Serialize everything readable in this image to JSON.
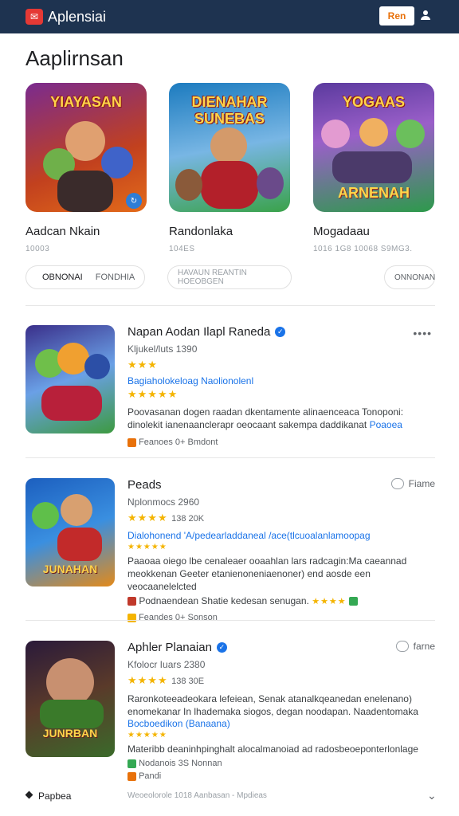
{
  "topbar": {
    "app_title": "Aplensiai",
    "button_label": "Ren"
  },
  "section_title": "Aaplirnsan",
  "featured": [
    {
      "thumb_text": "YIAYASAN",
      "name": "Aadcan Nkain",
      "sub": "10003",
      "colors": [
        "#7a2b8f",
        "#e36b1a"
      ]
    },
    {
      "thumb_text": "DIENAHAR SUNEBAS",
      "name": "Randonlaka",
      "sub": "104ES",
      "colors": [
        "#1c7bbf",
        "#3aa24a"
      ]
    },
    {
      "thumb_text": "YOGAAS",
      "name": "Mogadaau",
      "sub": "1016 1G8 10068 S9MG3.",
      "colors": [
        "#5b3a9e",
        "#2d9a4b"
      ]
    }
  ],
  "chips": {
    "left_a": "OBNONAI",
    "left_b": "FONDHIA",
    "middle": "HAVAUN REANTIN HOEOBGEN",
    "right": "ONNONAN"
  },
  "rows": [
    {
      "title": "Napan Aodan Ilapl Raneda",
      "meta": "Kljukel/luts 1390",
      "stars": "★★★",
      "link": "Bagiaholokeloag Naolionolenl",
      "stars2": "★★★★★",
      "desc": "Poovasanan dogen raadan dkentamente alinaenceaca Tonoponi: dinolekit ianenaanclerapr oeocaant sakempa daddikanat",
      "desc_link": "Poaoea",
      "foot": "Feanoes 0+ Bmdont"
    },
    {
      "title": "Peads",
      "action": "Fiame",
      "meta": "Nplonmocs 2960",
      "stars": "★★★★",
      "meta2": "138 20K",
      "link": "Dialohonend 'A/pedearladdaneal /ace(tlcuoalanlamoopag",
      "stars2": "★★★★★",
      "desc": "Paaoaa oiego lbe cenaleaer ooaahlan lars radcagin:Ma caeannad meokkenan Geeter etanienoneniaenoner) end aosde een veocaanelelcted",
      "desc2": "Podnaendean Shatie kedesan senugan.",
      "foot": "Feandes 0+ Sonson"
    },
    {
      "title": "Aphler Planaian",
      "action": "farne",
      "meta": "Kfolocr Iuars 2380",
      "stars": "★★★★",
      "meta2": "138 30E",
      "desc": "Raronkoteeadeokara lefeiean, Senak atanalkqeanedan enelenano) enomekanar In lhademaka siogos, degan noodapan. Naadentomaka",
      "link": "Bocboedikon (Banaana)",
      "stars2": "★★★★★",
      "desc2": "Materibb deaninhpinghalt alocalmanoiad ad radosbeoeponterlonlage",
      "foot": "Nodanois 3S Nonnan",
      "foot2": "Pandi"
    }
  ],
  "bottom": {
    "left": "Papbea",
    "middle": "Weoeolorole 1018 Aanbasan - Mpdieas"
  }
}
